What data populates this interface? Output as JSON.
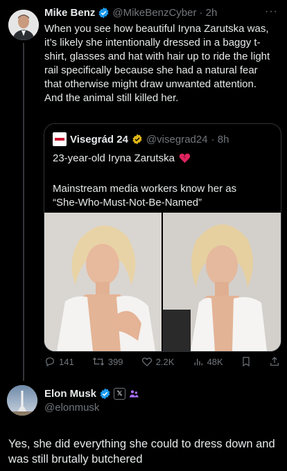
{
  "tweet": {
    "author_name": "Mike Benz",
    "author_handle": "@MikeBenzCyber",
    "time": "· 2h",
    "more_icon": "more-icon",
    "text": "When you see how beautiful Iryna Zarutska was, it’s likely she intentionally dressed in a baggy t-shirt, glasses and hat with hair up to ride the light rail specifically because she had a natural fear that otherwise might draw unwanted attention. And the animal still killed her."
  },
  "quote": {
    "author_name": "Visegrád 24",
    "author_handle": "@visegrad24",
    "time": "· 8h",
    "line1": "23-year-old Iryna Zarutska",
    "line2": "Mainstream media workers know her as “She-Who-Must-Not-Be-Named”"
  },
  "metrics": {
    "replies": "141",
    "retweets": "399",
    "likes": "2.2K",
    "views": "48K"
  },
  "reply": {
    "author_name": "Elon Musk",
    "author_handle": "@elonmusk",
    "text": "Yes, she did everything she could to dress down and was still brutally butchered"
  },
  "colors": {
    "background": "#000000",
    "text": "#e7e9ea",
    "secondary": "#71767b",
    "verified_blue": "#1d9bf0",
    "verified_gold": "#e2b719",
    "heart": "#e0245e"
  }
}
